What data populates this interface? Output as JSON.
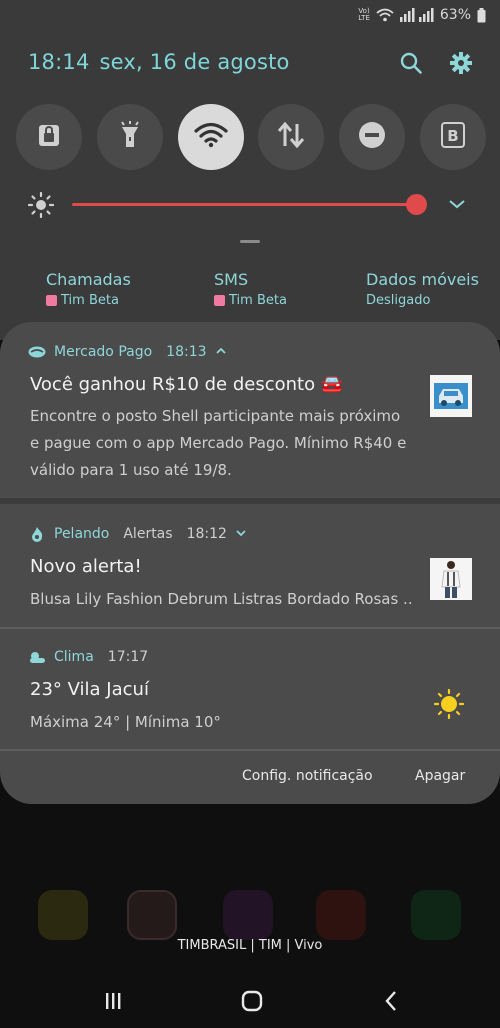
{
  "status_bar": {
    "volte_top": "Vo)",
    "volte_bottom": "LTE",
    "battery": "63%"
  },
  "header": {
    "time": "18:14",
    "date": "sex, 16 de agosto"
  },
  "quick_tiles": [
    {
      "icon": "lock-icon",
      "active": false
    },
    {
      "icon": "flashlight-icon",
      "active": false
    },
    {
      "icon": "wifi-icon",
      "active": true
    },
    {
      "icon": "mobile-data-icon",
      "active": false
    },
    {
      "icon": "do-not-disturb-icon",
      "active": false
    },
    {
      "icon": "bixby-icon",
      "active": false
    }
  ],
  "brightness": {
    "level": 0.95
  },
  "sims": {
    "calls_label": "Chamadas",
    "calls_value": "Tim Beta",
    "sms_label": "SMS",
    "sms_value": "Tim Beta",
    "data_label": "Dados móveis",
    "data_value": "Desligado"
  },
  "notifications": [
    {
      "app": "Mercado Pago",
      "time": "18:13",
      "title": "Você ganhou R$10 de desconto 🚘",
      "body_lines": [
        "Encontre o posto Shell participante mais próximo",
        "e pague com o app Mercado Pago. Mínimo R$40 e",
        "válido para 1 uso até 19/8."
      ]
    },
    {
      "app": "Pelando",
      "category": "Alertas",
      "time": "18:12",
      "title": "Novo alerta!",
      "body_lines": [
        "Blusa Lily Fashion Debrum Listras Bordado Rosas .."
      ]
    },
    {
      "app": "Clima",
      "time": "17:17",
      "title": "23° Vila Jacuí",
      "body_lines": [
        "Máxima 24° | Mínima 10°"
      ]
    }
  ],
  "actions": {
    "settings": "Config. notificação",
    "clear": "Apagar"
  },
  "carrier": "TIMBRASIL | TIM | Vivo",
  "colors": {
    "accent": "#8fd6d9",
    "slider": "#e04a4a",
    "panel": "#4b4b4b"
  }
}
